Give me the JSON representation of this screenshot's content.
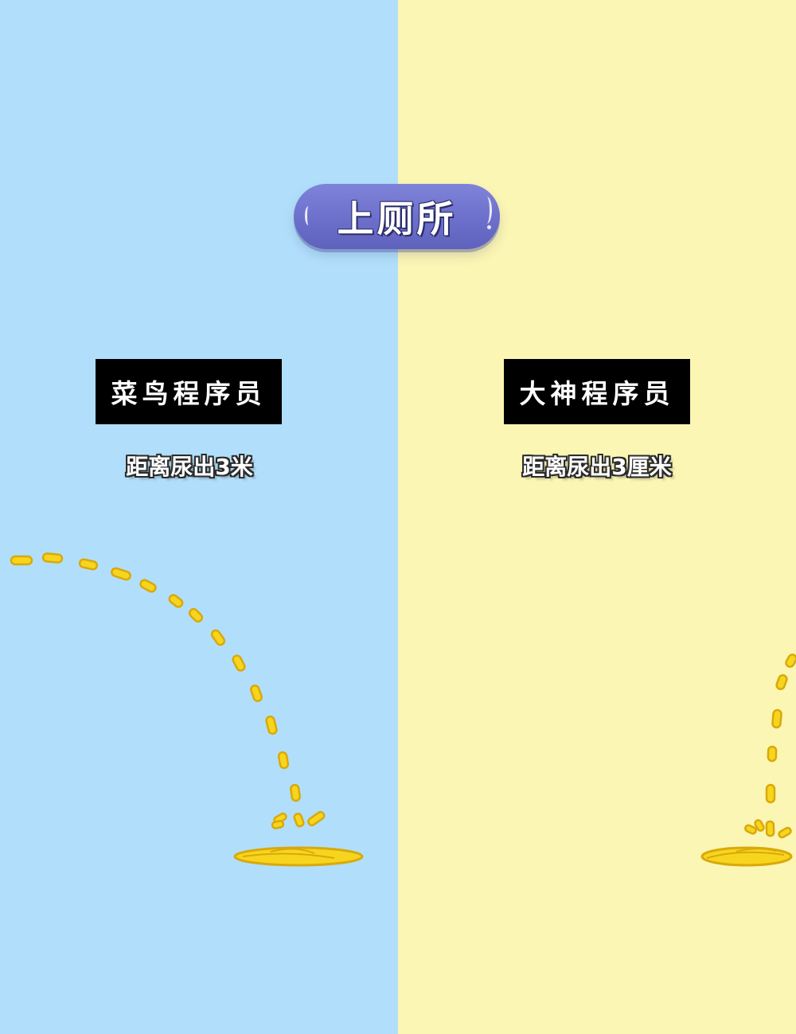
{
  "title": "上厕所",
  "left": {
    "label": "菜鸟程序员",
    "caption": "距离尿出3米"
  },
  "right": {
    "label": "大神程序员",
    "caption": "距离尿出3厘米"
  },
  "colors": {
    "left_background": "#b1dffb",
    "right_background": "#fbf6b4",
    "title_pill": "#6b6ec9",
    "label_box": "#000000",
    "liquid": "#f7d51e",
    "liquid_outline": "#d9a90a"
  }
}
